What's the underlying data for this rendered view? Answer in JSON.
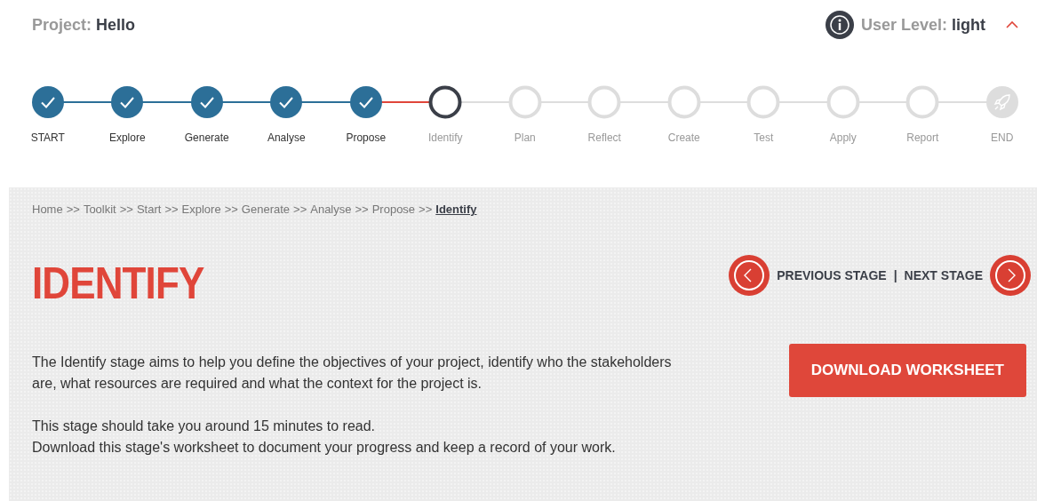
{
  "header": {
    "project_label": "Project:",
    "project_name": "Hello",
    "user_level_label": "User Level:",
    "user_level_value": "light",
    "expanded": true
  },
  "stepper": [
    {
      "label": "START",
      "kind": "done"
    },
    {
      "label": "Explore",
      "kind": "done"
    },
    {
      "label": "Generate",
      "kind": "done"
    },
    {
      "label": "Analyse",
      "kind": "done"
    },
    {
      "label": "Propose",
      "kind": "done"
    },
    {
      "label": "Identify",
      "kind": "current"
    },
    {
      "label": "Plan",
      "kind": "todo"
    },
    {
      "label": "Reflect",
      "kind": "todo"
    },
    {
      "label": "Create",
      "kind": "todo"
    },
    {
      "label": "Test",
      "kind": "todo"
    },
    {
      "label": "Apply",
      "kind": "todo"
    },
    {
      "label": "Report",
      "kind": "todo"
    },
    {
      "label": "END",
      "kind": "end"
    }
  ],
  "breadcrumb": {
    "separator": ">>",
    "items": [
      {
        "label": "Home",
        "current": false
      },
      {
        "label": "Toolkit",
        "current": false
      },
      {
        "label": "Start",
        "current": false
      },
      {
        "label": "Explore",
        "current": false
      },
      {
        "label": "Generate",
        "current": false
      },
      {
        "label": "Analyse",
        "current": false
      },
      {
        "label": "Propose",
        "current": false
      },
      {
        "label": "Identify",
        "current": true
      }
    ]
  },
  "title": "IDENTIFY",
  "stage_nav": {
    "previous": "PREVIOUS STAGE",
    "divider": "|",
    "next": "NEXT STAGE"
  },
  "paragraphs": [
    [
      "The Identify stage aims to help you define the objectives of your project, identify who the stakeholders are, what resources are required and what the context for the project is."
    ],
    [
      "This stage should take you around 15 minutes to read.",
      "Download this stage's worksheet to document your progress and keep a record of your work."
    ]
  ],
  "download_button": "DOWNLOAD WORKSHEET"
}
